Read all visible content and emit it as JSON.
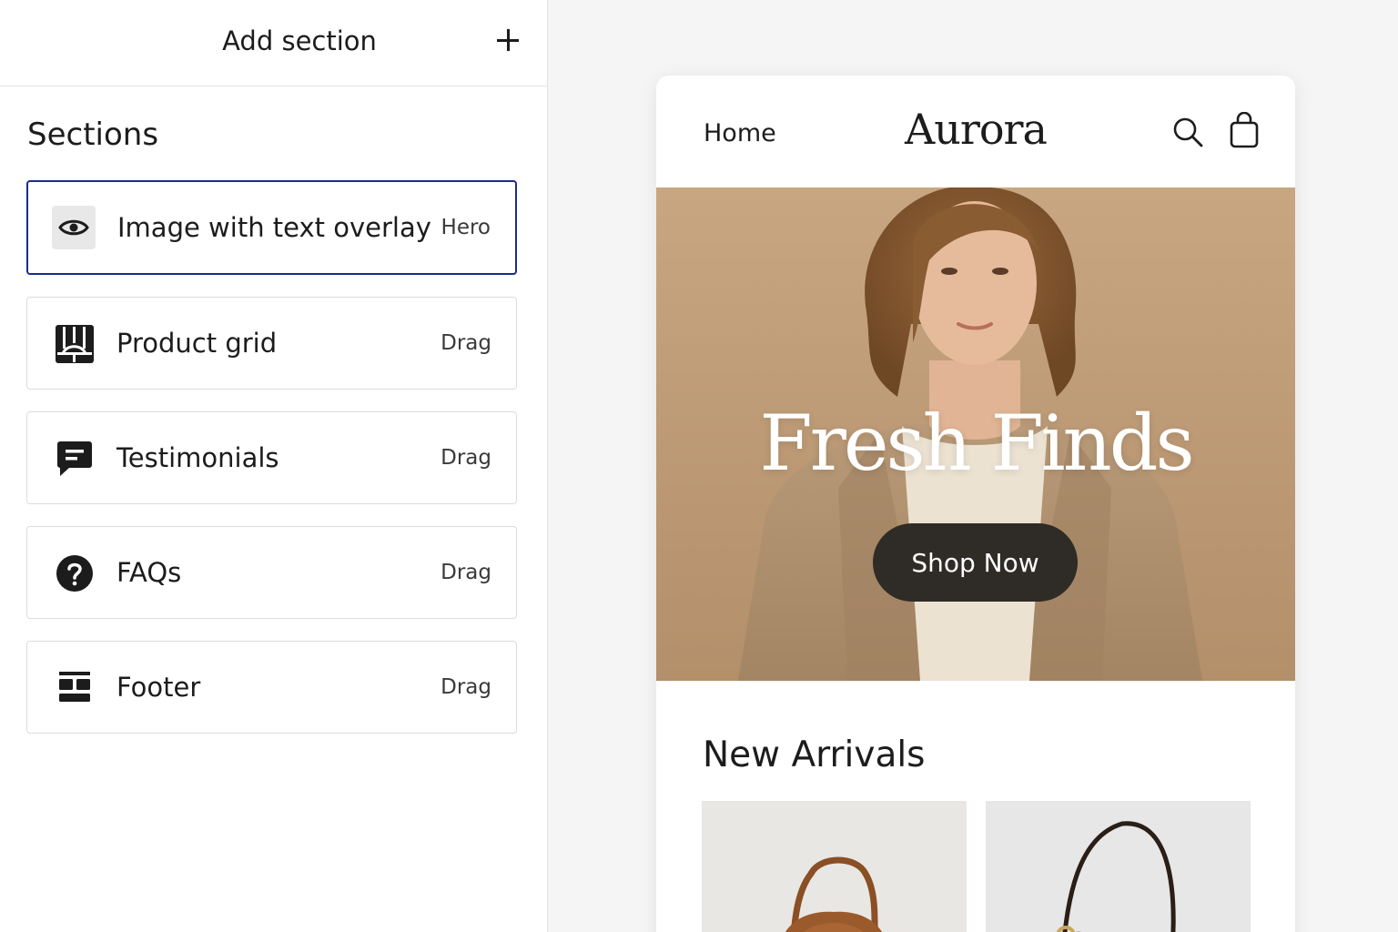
{
  "editor": {
    "add_section_label": "Add section",
    "sections_title": "Sections",
    "sections": [
      {
        "name": "Image with text overlay",
        "tag": "Hero",
        "icon": "eye-icon",
        "active": true
      },
      {
        "name": "Product grid",
        "tag": "Drag",
        "icon": "product-grid-icon",
        "active": false
      },
      {
        "name": "Testimonials",
        "tag": "Drag",
        "icon": "chat-bubble-icon",
        "active": false
      },
      {
        "name": "FAQs",
        "tag": "Drag",
        "icon": "question-circle-icon",
        "active": false
      },
      {
        "name": "Footer",
        "tag": "Drag",
        "icon": "footer-layout-icon",
        "active": false
      }
    ],
    "accent_color": "#1e2a8c"
  },
  "preview": {
    "nav": {
      "home_label": "Home",
      "brand": "Aurora",
      "search_icon": "search-icon",
      "bag_icon": "shopping-bag-icon"
    },
    "hero": {
      "title": "Fresh Finds",
      "button_label": "Shop Now",
      "background_color": "#c2a07c",
      "button_color": "#2f2b26"
    },
    "new_arrivals": {
      "title": "New Arrivals",
      "products": [
        {
          "image": "brown-leather-handbag"
        },
        {
          "image": "black-shoulder-bag"
        }
      ]
    }
  }
}
